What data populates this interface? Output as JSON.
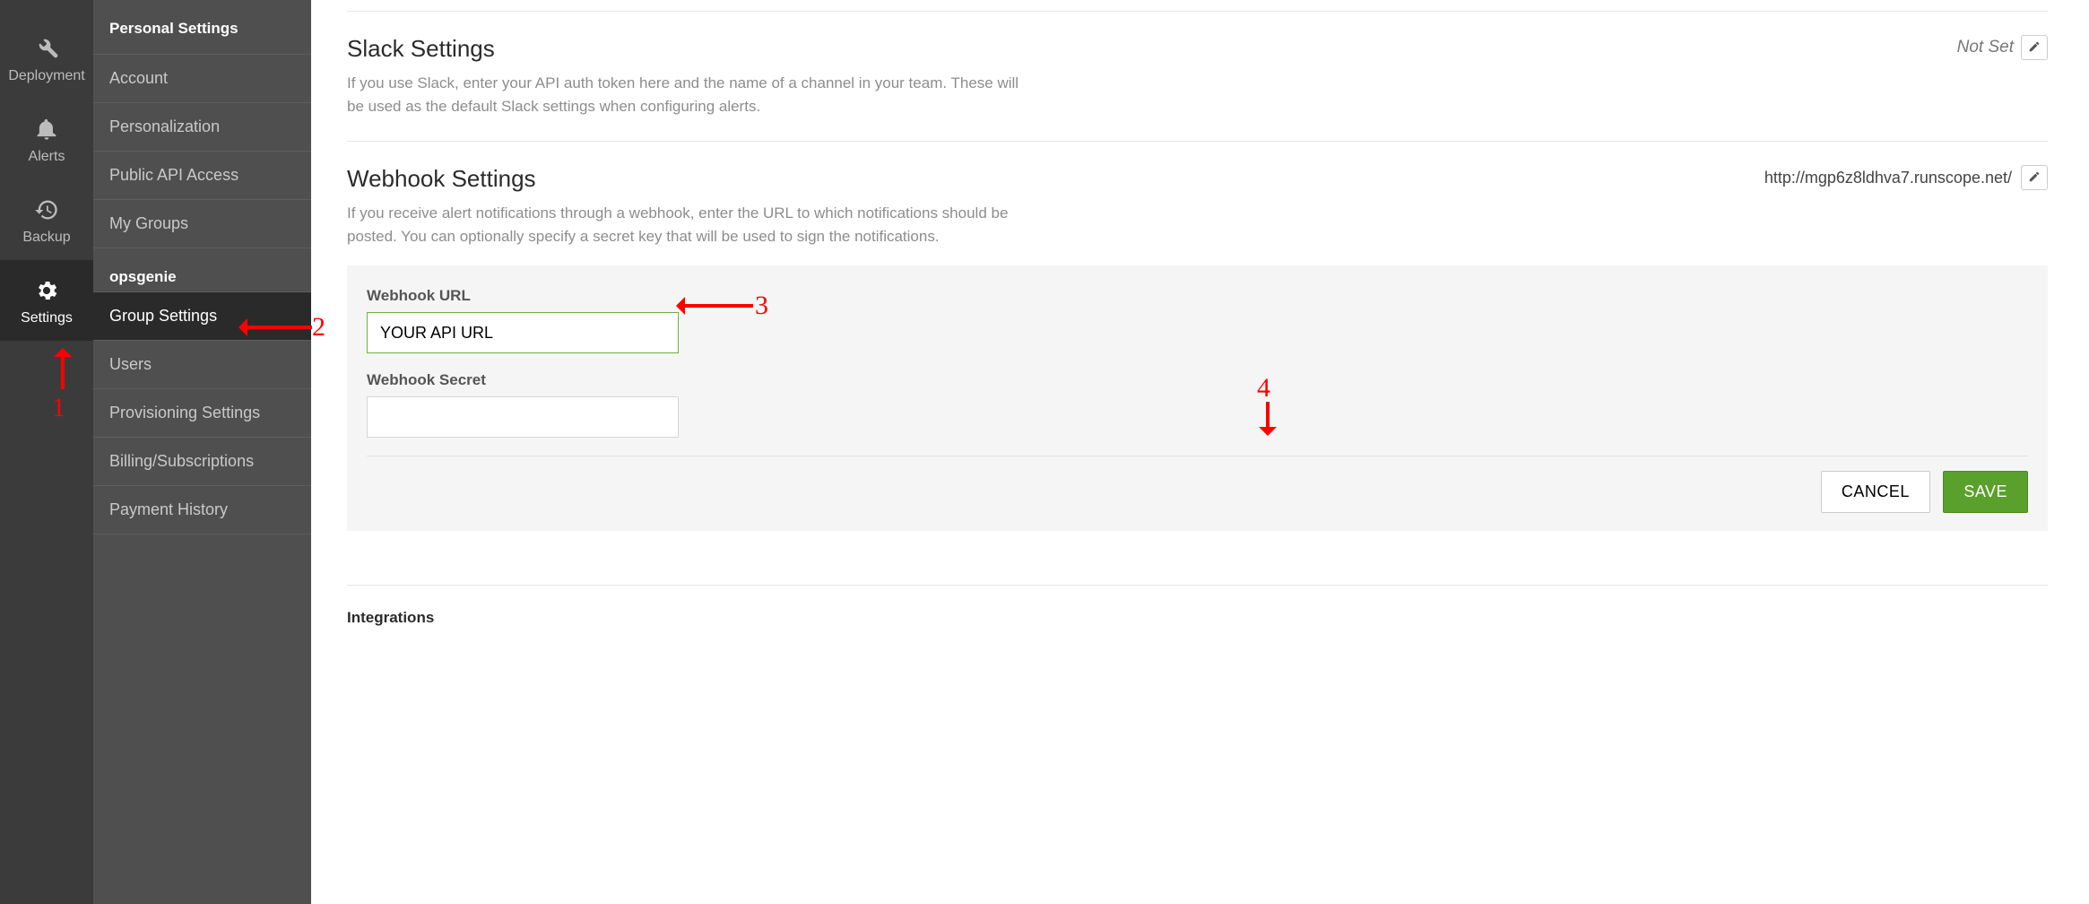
{
  "iconRail": {
    "items": [
      {
        "label": "Deployment",
        "icon": "deployment"
      },
      {
        "label": "Alerts",
        "icon": "bell"
      },
      {
        "label": "Backup",
        "icon": "history"
      },
      {
        "label": "Settings",
        "icon": "gear",
        "active": true
      }
    ]
  },
  "sidebar": {
    "sections": [
      {
        "title": "Personal Settings",
        "items": [
          {
            "label": "Account"
          },
          {
            "label": "Personalization"
          },
          {
            "label": "Public API Access"
          },
          {
            "label": "My Groups"
          }
        ]
      },
      {
        "title": "opsgenie",
        "items": [
          {
            "label": "Group Settings",
            "active": true
          },
          {
            "label": "Users"
          },
          {
            "label": "Provisioning Settings"
          },
          {
            "label": "Billing/Subscriptions"
          },
          {
            "label": "Payment History"
          }
        ]
      }
    ]
  },
  "slack": {
    "title": "Slack Settings",
    "desc": "If you use Slack, enter your API auth token here and the name of a channel in your team. These will be used as the default Slack settings when configuring alerts.",
    "status": "Not Set"
  },
  "webhook": {
    "title": "Webhook Settings",
    "desc": "If you receive alert notifications through a webhook, enter the URL to which notifications should be posted. You can optionally specify a secret key that will be used to sign the notifications.",
    "status": "http://mgp6z8ldhva7.runscope.net/",
    "form": {
      "urlLabel": "Webhook URL",
      "urlValue": "YOUR API URL",
      "secretLabel": "Webhook Secret",
      "secretValue": "",
      "cancel": "CANCEL",
      "save": "SAVE"
    }
  },
  "integrationsTitle": "Integrations",
  "annotations": {
    "n1": "1",
    "n2": "2",
    "n3": "3",
    "n4": "4"
  }
}
